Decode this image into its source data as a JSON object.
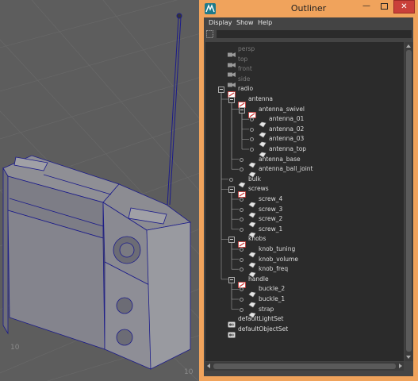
{
  "window": {
    "title": "Outliner",
    "min_glyph": "—",
    "close_glyph": "✕",
    "accent_color": "#f0a35c",
    "close_color": "#c9403a"
  },
  "menu": [
    "Display",
    "Show",
    "Help"
  ],
  "search": {
    "value": "",
    "placeholder": ""
  },
  "viewport": {
    "labels": [
      "10",
      "10"
    ],
    "background": "#5d5d5d",
    "wire_color": "#1b1b8a"
  },
  "outliner_rows": [
    {
      "label": "persp",
      "icon": "camera-icon",
      "depth": 0,
      "dim": true,
      "expanded": null,
      "connector": false
    },
    {
      "label": "top",
      "icon": "camera-icon",
      "depth": 0,
      "dim": true,
      "expanded": null,
      "connector": false
    },
    {
      "label": "front",
      "icon": "camera-icon",
      "depth": 0,
      "dim": true,
      "expanded": null,
      "connector": false
    },
    {
      "label": "side",
      "icon": "camera-icon",
      "depth": 0,
      "dim": true,
      "expanded": null,
      "connector": false
    },
    {
      "label": "radio",
      "icon": "group-icon",
      "depth": 0,
      "dim": false,
      "expanded": true,
      "connector": false
    },
    {
      "label": "antenna",
      "icon": "group-icon",
      "depth": 1,
      "dim": false,
      "expanded": true,
      "connector": false
    },
    {
      "label": "antenna_swivel",
      "icon": "group-icon",
      "depth": 2,
      "dim": false,
      "expanded": true,
      "connector": false
    },
    {
      "label": "antenna_01",
      "icon": "mesh-icon",
      "depth": 3,
      "dim": false,
      "expanded": null,
      "connector": true
    },
    {
      "label": "antenna_02",
      "icon": "mesh-icon",
      "depth": 3,
      "dim": false,
      "expanded": null,
      "connector": true
    },
    {
      "label": "antenna_03",
      "icon": "mesh-icon",
      "depth": 3,
      "dim": false,
      "expanded": null,
      "connector": true
    },
    {
      "label": "antenna_top",
      "icon": "mesh-icon",
      "depth": 3,
      "dim": false,
      "expanded": null,
      "connector": true
    },
    {
      "label": "antenna_base",
      "icon": "mesh-icon",
      "depth": 2,
      "dim": false,
      "expanded": null,
      "connector": true
    },
    {
      "label": "antenna_ball_joint",
      "icon": "mesh-icon",
      "depth": 2,
      "dim": false,
      "expanded": null,
      "connector": true
    },
    {
      "label": "bulk",
      "icon": "mesh-icon",
      "depth": 1,
      "dim": false,
      "expanded": null,
      "connector": true
    },
    {
      "label": "screws",
      "icon": "group-icon",
      "depth": 1,
      "dim": false,
      "expanded": true,
      "connector": false
    },
    {
      "label": "screw_4",
      "icon": "mesh-icon",
      "depth": 2,
      "dim": false,
      "expanded": null,
      "connector": true
    },
    {
      "label": "screw_3",
      "icon": "mesh-icon",
      "depth": 2,
      "dim": false,
      "expanded": null,
      "connector": true
    },
    {
      "label": "screw_2",
      "icon": "mesh-icon",
      "depth": 2,
      "dim": false,
      "expanded": null,
      "connector": true
    },
    {
      "label": "screw_1",
      "icon": "mesh-icon",
      "depth": 2,
      "dim": false,
      "expanded": null,
      "connector": true
    },
    {
      "label": "knobs",
      "icon": "group-icon",
      "depth": 1,
      "dim": false,
      "expanded": true,
      "connector": false
    },
    {
      "label": "knob_tuning",
      "icon": "mesh-icon",
      "depth": 2,
      "dim": false,
      "expanded": null,
      "connector": true
    },
    {
      "label": "knob_volume",
      "icon": "mesh-icon",
      "depth": 2,
      "dim": false,
      "expanded": null,
      "connector": true
    },
    {
      "label": "knob_freq",
      "icon": "mesh-icon",
      "depth": 2,
      "dim": false,
      "expanded": null,
      "connector": true
    },
    {
      "label": "handle",
      "icon": "group-icon",
      "depth": 1,
      "dim": false,
      "expanded": true,
      "connector": false
    },
    {
      "label": "buckle_2",
      "icon": "mesh-icon",
      "depth": 2,
      "dim": false,
      "expanded": null,
      "connector": true
    },
    {
      "label": "buckle_1",
      "icon": "mesh-icon",
      "depth": 2,
      "dim": false,
      "expanded": null,
      "connector": true
    },
    {
      "label": "strap",
      "icon": "mesh-icon",
      "depth": 2,
      "dim": false,
      "expanded": null,
      "connector": true
    },
    {
      "label": "defaultLightSet",
      "icon": "set-icon",
      "depth": 0,
      "dim": false,
      "expanded": null,
      "connector": false
    },
    {
      "label": "defaultObjectSet",
      "icon": "set-icon",
      "depth": 0,
      "dim": false,
      "expanded": null,
      "connector": false
    }
  ]
}
